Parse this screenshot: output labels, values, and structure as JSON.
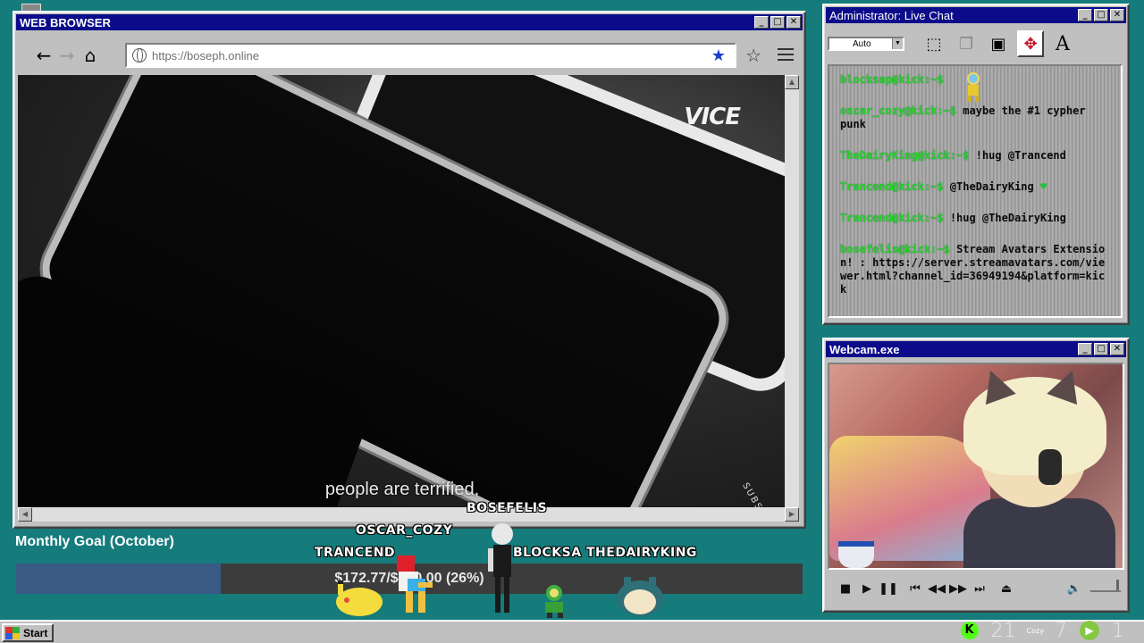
{
  "browser": {
    "title": "WEB BROWSER",
    "url": "https://boseph.online",
    "video": {
      "logo": "VICE",
      "subtitle": "people are terrified,",
      "corner_text": "SUBSC"
    }
  },
  "chat": {
    "title": "Administrator: Live Chat",
    "auto_label": "Auto",
    "messages": [
      {
        "user": "blocksap@kick:~$",
        "text": ""
      },
      {
        "user": "oscar_cozy@kick:~$",
        "text": "maybe the #1 cypher punk"
      },
      {
        "user": "TheDairyKing@kick:~$",
        "text": "!hug @Trancend"
      },
      {
        "user": "Trancend@kick:~$",
        "text": "@TheDairyKing"
      },
      {
        "user": "Trancend@kick:~$",
        "text": "!hug @TheDairyKing"
      },
      {
        "user": "bosefelis@kick:~$",
        "text": "Stream Avatars Extension! : https://server.streamavatars.com/viewer.html?channel_id=36949194&platform=kick"
      }
    ]
  },
  "webcam": {
    "title": "Webcam.exe"
  },
  "goal": {
    "label": "Monthly Goal (October)",
    "progress_text": "$172.77/$660.00 (26%)",
    "progress": 0.26
  },
  "avatars": {
    "names": [
      "OSCAR_COZY",
      "BOSEFELIS",
      "TRANCEND",
      "BLOCKSA",
      "THEDAIRYKING"
    ]
  },
  "taskbar": {
    "start_label": "Start",
    "kick_count": "21",
    "cozy_label": "Cozy",
    "cozy_count": "7",
    "rumble_count": "1"
  },
  "colors": {
    "desktop": "#157b7b",
    "titlebar": "#0c0c8a",
    "chat_user": "#2ad22a",
    "goal_fill": "#3a5a86"
  }
}
